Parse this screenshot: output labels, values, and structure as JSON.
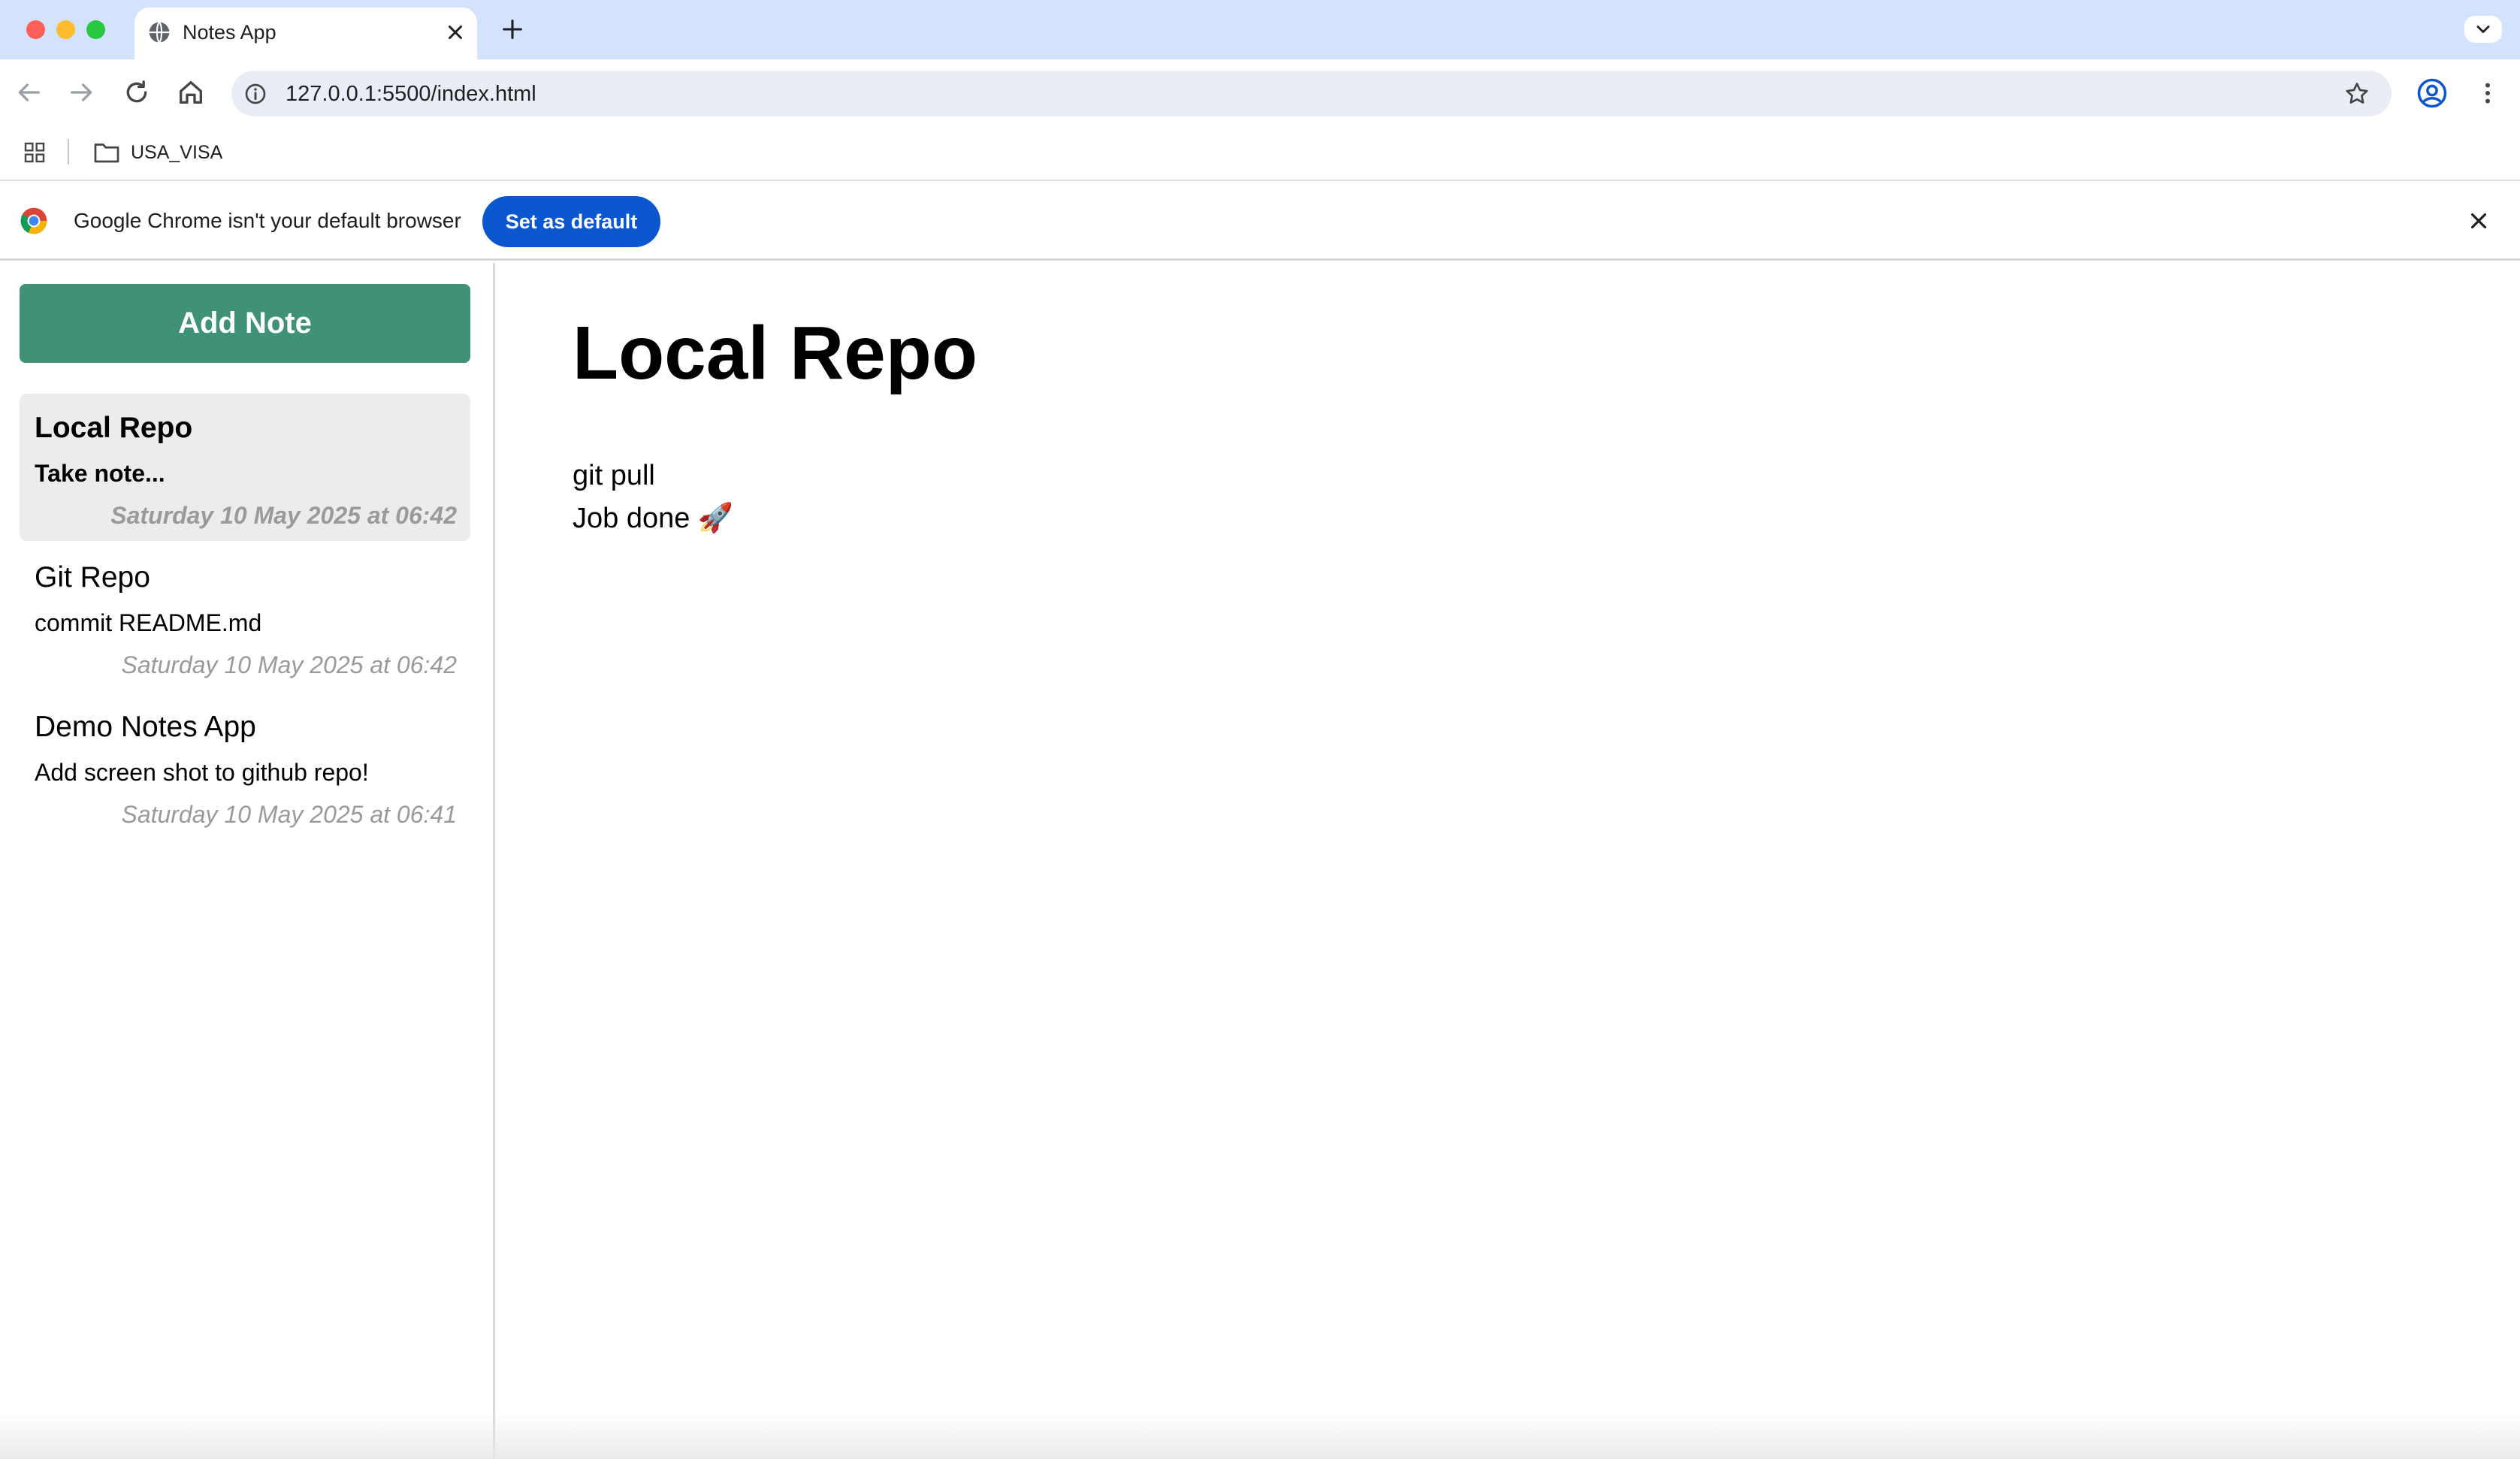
{
  "browser": {
    "tab": {
      "title": "Notes App",
      "favicon": "globe-icon"
    },
    "url": "127.0.0.1:5500/index.html",
    "bookmarks": [
      {
        "label": "USA_VISA",
        "icon": "folder-icon"
      }
    ],
    "infobar": {
      "message": "Google Chrome isn't your default browser",
      "button_label": "Set as default"
    }
  },
  "sidebar": {
    "add_button_label": "Add Note",
    "notes": [
      {
        "title": "Local Repo",
        "preview": "Take note...",
        "date": "Saturday 10 May 2025 at 06:42",
        "active": true
      },
      {
        "title": "Git Repo",
        "preview": "commit README.md",
        "date": "Saturday 10 May 2025 at 06:42",
        "active": false
      },
      {
        "title": "Demo Notes App",
        "preview": "Add screen shot to github repo!",
        "date": "Saturday 10 May 2025 at 06:41",
        "active": false
      }
    ]
  },
  "main": {
    "title": "Local Repo",
    "body_lines": [
      "git pull",
      "Job done 🚀"
    ]
  },
  "colors": {
    "tabstrip_bg": "#d3e3fd",
    "add_button_bg": "#3f9178",
    "set_default_bg": "#0b57d0",
    "active_note_bg": "#ececec",
    "date_text": "#9a9a9a"
  }
}
